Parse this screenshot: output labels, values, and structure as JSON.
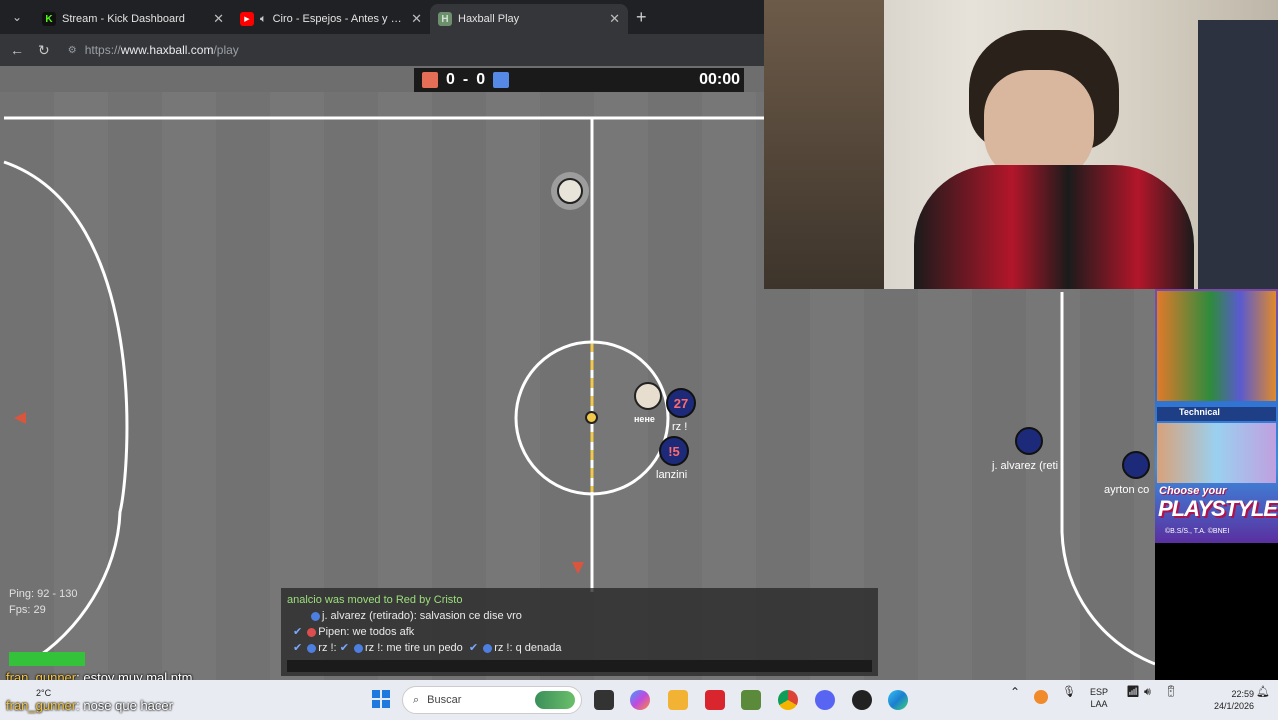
{
  "browser": {
    "tabs": [
      {
        "title": "Stream - Kick Dashboard",
        "favicon": "K",
        "favicon_color": "#53fc18",
        "active": false
      },
      {
        "title": "Ciro - Espejos - Antes y desp",
        "favicon": "▶",
        "favicon_color": "#ff0000",
        "active": false
      },
      {
        "title": "Haxball Play",
        "favicon": "H",
        "favicon_color": "#6e8f6e",
        "active": true
      }
    ],
    "url_scheme": "https://",
    "url_host": "www.haxball.com",
    "url_path": "/play"
  },
  "game": {
    "score_red": "0",
    "score_sep": "-",
    "score_blue": "0",
    "time": "00:00",
    "red_color": "#e56e56",
    "blue_color": "#5689e5",
    "ping": "Ping: 92 - 130",
    "fps": "Fps: 29",
    "players": [
      {
        "label": "27",
        "name": "rz !",
        "team": "blue"
      },
      {
        "label": "!5",
        "name": "lanzini",
        "team": "blue"
      },
      {
        "label": "",
        "name": "нене",
        "team": "neutral"
      },
      {
        "label": "",
        "name": "j. alvarez (reti",
        "team": "blue"
      },
      {
        "label": "",
        "name": "ayrton co",
        "team": "blue"
      }
    ]
  },
  "chat": {
    "lines": [
      {
        "text": "analcio was moved to Red by Cristo"
      },
      {
        "text": "j. alvarez (retirado): salvasion ce dise vro"
      },
      {
        "text": "Pipen: we todos afk"
      },
      {
        "p1": "rz !:",
        "p2": "rz !: me tire un pedo",
        "p3": "rz !: q denada"
      }
    ]
  },
  "stream_chat": [
    {
      "user": "fran_gunner",
      "msg": ": estoy muy mal ptm"
    },
    {
      "user": "fran_gunner",
      "msg": ": nose que hacer"
    }
  ],
  "ad": {
    "technical": "Technical",
    "choose": "Choose your",
    "playstyle": "PLAYSTYLE",
    "copy": "©B.S/S., T.A. ©BNEI"
  },
  "taskbar": {
    "weather": "2°C",
    "search_placeholder": "Buscar",
    "lang": "ESP",
    "lang2": "LAA",
    "time": "22:59",
    "date": "24/1/2026"
  }
}
